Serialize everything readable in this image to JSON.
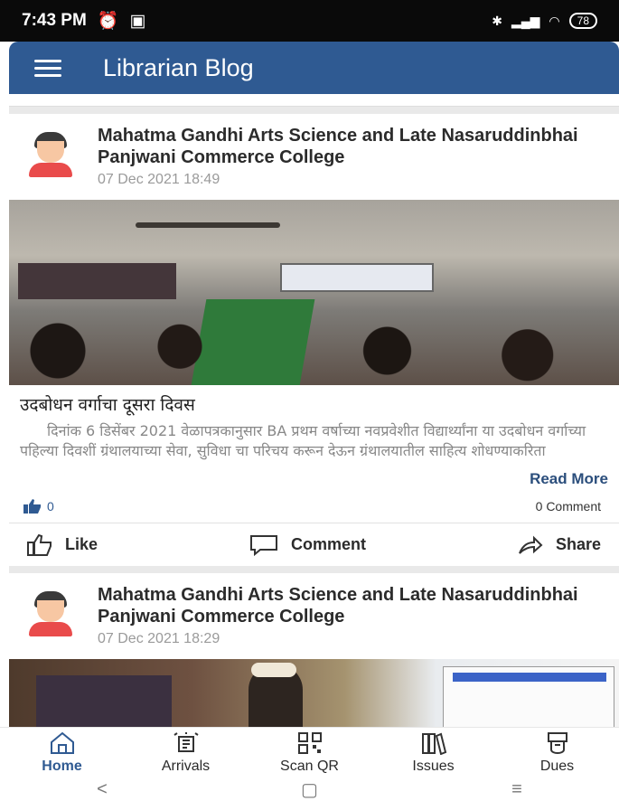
{
  "status_bar": {
    "time": "7:43 PM",
    "battery": "78"
  },
  "app_bar": {
    "title": "Librarian Blog"
  },
  "posts": [
    {
      "author": "Mahatma Gandhi Arts Science and Late Nasaruddinbhai Panjwani Commerce College",
      "date": "07 Dec 2021 18:49",
      "title": "उदबोधन वर्गाचा दूसरा दिवस",
      "body": "दिनांक 6 डिसेंबर 2021 वेळापत्रकानुसार BA प्रथम वर्षाच्या नवप्रवेशीत विद्यार्थ्यांना या उदबोधन वर्गाच्या पहिल्या दिवशीं ग्रंथालयाच्या सेवा, सुविधा चा परिचय करून देऊन ग्रंथालयातील साहित्य शोधण्याकरिता",
      "read_more": "Read More",
      "like_count": "0",
      "comment_count": "0 Comment",
      "actions": {
        "like": "Like",
        "comment": "Comment",
        "share": "Share"
      }
    },
    {
      "author": "Mahatma Gandhi Arts Science and Late Nasaruddinbhai Panjwani Commerce College",
      "date": "07 Dec 2021 18:29"
    }
  ],
  "bottom_nav": [
    {
      "label": "Home",
      "icon": "home-icon"
    },
    {
      "label": "Arrivals",
      "icon": "arrivals-icon"
    },
    {
      "label": "Scan QR",
      "icon": "qr-icon"
    },
    {
      "label": "Issues",
      "icon": "books-icon"
    },
    {
      "label": "Dues",
      "icon": "dues-icon"
    }
  ],
  "system_nav": {
    "back": "<",
    "home": "▢",
    "recents": "≡"
  },
  "colors": {
    "primary": "#2f5a92",
    "accent_text": "#2b4e7c"
  }
}
